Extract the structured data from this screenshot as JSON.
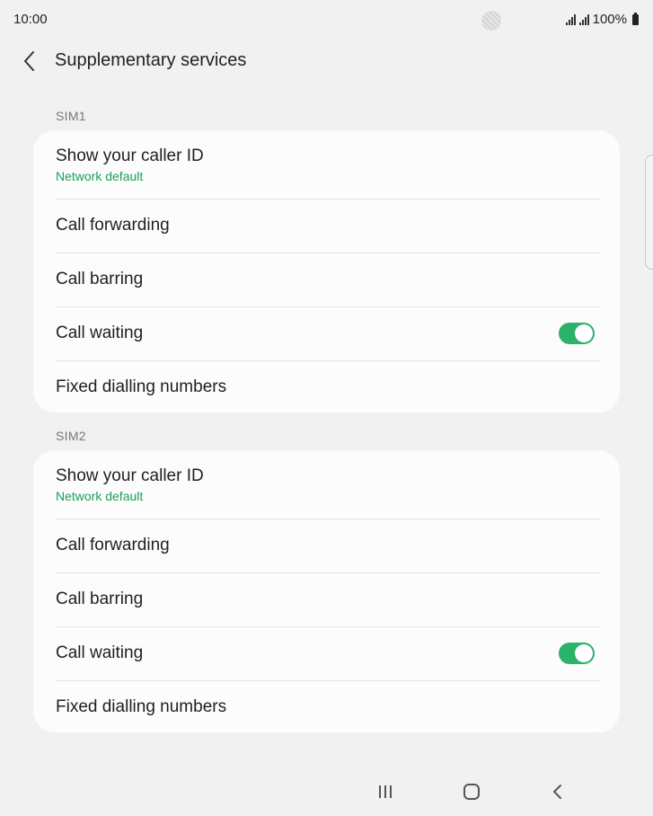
{
  "status_bar": {
    "time": "10:00",
    "battery": "100%",
    "icons": [
      "camera-cutout",
      "signal-icon",
      "signal-icon",
      "battery-icon"
    ]
  },
  "header": {
    "title": "Supplementary services",
    "back_icon": "back-arrow-icon"
  },
  "sections": [
    {
      "label": "SIM1",
      "items": [
        {
          "title": "Show your caller ID",
          "subtitle": "Network default"
        },
        {
          "title": "Call forwarding"
        },
        {
          "title": "Call barring"
        },
        {
          "title": "Call waiting",
          "toggle_on": true
        },
        {
          "title": "Fixed dialling numbers"
        }
      ]
    },
    {
      "label": "SIM2",
      "items": [
        {
          "title": "Show your caller ID",
          "subtitle": "Network default"
        },
        {
          "title": "Call forwarding"
        },
        {
          "title": "Call barring"
        },
        {
          "title": "Call waiting",
          "toggle_on": true
        },
        {
          "title": "Fixed dialling numbers"
        }
      ]
    }
  ],
  "colors": {
    "accent": "#2bb36a",
    "subtitle": "#1a9e5a",
    "background": "#f1f1f1",
    "card": "#fcfcfc"
  },
  "nav_bar": {
    "icons": [
      "recent-apps-icon",
      "home-icon",
      "back-icon"
    ]
  }
}
